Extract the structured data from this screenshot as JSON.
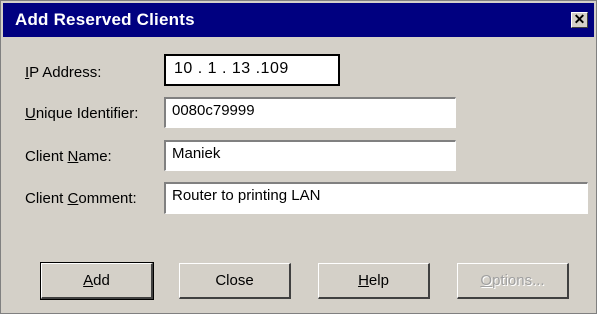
{
  "window": {
    "title": "Add Reserved Clients",
    "close_glyph": "✕"
  },
  "form": {
    "ip_label_mnemonic": "I",
    "ip_label_rest": "P Address:",
    "ip_value": "10 . 1 . 13 .109",
    "uid_label_mnemonic": "U",
    "uid_label_rest": "nique Identifier:",
    "uid_value": "0080c79999",
    "name_label_pre": "Client ",
    "name_label_mnemonic": "N",
    "name_label_rest": "ame:",
    "name_value": "Maniek",
    "comment_label_pre": "Client ",
    "comment_label_mnemonic": "C",
    "comment_label_rest": "omment:",
    "comment_value": "Router to printing LAN"
  },
  "buttons": {
    "add_mnemonic": "A",
    "add_rest": "dd",
    "close_label": "Close",
    "help_mnemonic": "H",
    "help_rest": "elp",
    "options_mnemonic": "O",
    "options_rest": "ptions..."
  },
  "icons": {
    "close": "close-icon"
  },
  "colors": {
    "titlebar": "#000080",
    "dialog_bg": "#d4d0c8",
    "field_bg": "#ffffff",
    "disabled_text": "#a0a0a0"
  }
}
